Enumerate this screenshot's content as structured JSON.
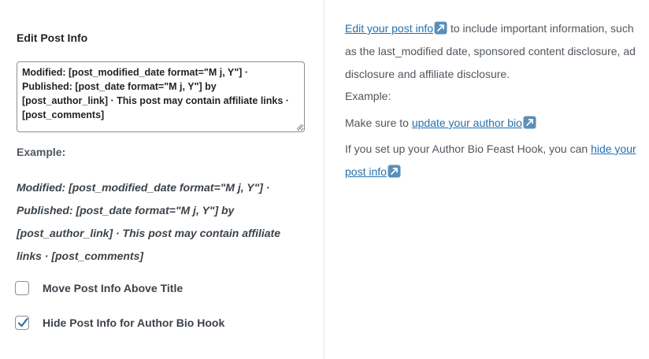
{
  "left": {
    "section_title": "Edit Post Info",
    "textarea_value": "Modified: [post_modified_date format=\"M j, Y\"] · Published: [post_date format=\"M j, Y\"] by [post_author_link] · This post may contain affiliate links · [post_comments]",
    "example_label": "Example:",
    "example_text": "Modified: [post_modified_date format=\"M j, Y\"] · Published: [post_date format=\"M j, Y\"] by [post_author_link] · This post may contain affiliate links · [post_comments]",
    "checkboxes": [
      {
        "label": "Move Post Info Above Title",
        "checked": false
      },
      {
        "label": "Hide Post Info for Author Bio Hook",
        "checked": true
      }
    ]
  },
  "right": {
    "p1_link": "Edit your post info",
    "p1_text": " to include important information, such as the last_modified date, sponsored content disclosure, ad disclosure and affiliate disclosure.",
    "p1_example": "Example:",
    "p2_text": "Make sure to ",
    "p2_link": "update your author bio",
    "p3_text": "If you set up your Author Bio Feast Hook, you can ",
    "p3_link": "hide your post info"
  },
  "icons": {
    "external": "external-link-icon",
    "check": "check-icon"
  },
  "colors": {
    "link": "#2271b1",
    "check": "#2271b1",
    "ext_icon_bg": "#5b8fb9"
  }
}
